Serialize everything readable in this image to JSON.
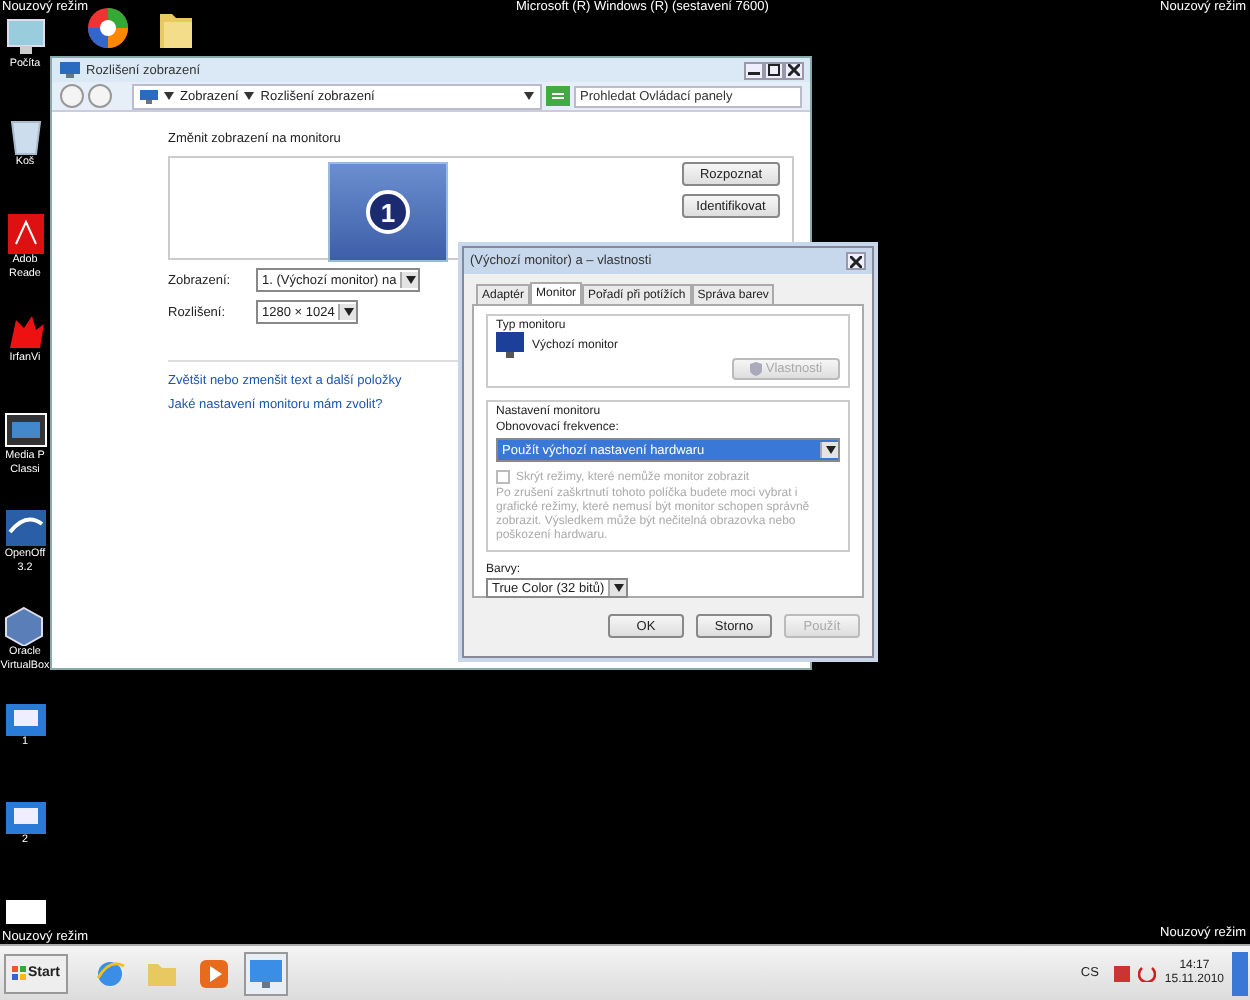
{
  "overlay_texts": {
    "top_left": "Nouzový režim",
    "top_center": "Microsoft (R) Windows (R) (sestavení 7600)",
    "top_right": "Nouzový režim",
    "bottom_left": "Nouzový režim",
    "bottom_right": "Nouzový režim"
  },
  "top_icons": [
    {
      "kind": "picasa"
    },
    {
      "kind": "folder"
    }
  ],
  "desktop_icons": [
    {
      "kind": "computer",
      "label": [
        "Počíta"
      ]
    },
    {
      "kind": "recycle",
      "label": [
        "Koš"
      ]
    },
    {
      "kind": "pdf",
      "label": [
        "Adob",
        "Reade"
      ]
    },
    {
      "kind": "irfan",
      "label": [
        "IrfanVi"
      ]
    },
    {
      "kind": "media",
      "label": [
        "Media P",
        "Classi"
      ]
    },
    {
      "kind": "office",
      "label": [
        "OpenOff",
        "3.2"
      ]
    },
    {
      "kind": "virtualbox",
      "label": [
        "Oracle",
        "VirtualBox"
      ]
    },
    {
      "kind": "screenshot",
      "label": [
        "1"
      ]
    },
    {
      "kind": "screenshot",
      "label": [
        "2"
      ]
    },
    {
      "kind": "blank"
    }
  ],
  "main_window": {
    "title": "Rozlišení zobrazení",
    "breadcrumb": [
      "Zobrazení",
      "Rozlišení zobrazení"
    ],
    "search": {
      "placeholder": "Prohledat Ovládací panely"
    },
    "heading": "Změnit zobrazení na monitoru",
    "monitor_number": "1",
    "buttons": [
      "Rozpoznat",
      "Identifikovat"
    ],
    "fields": [
      {
        "label": "Zobrazení:",
        "value": "1. (Výchozí monitor) na"
      },
      {
        "label": "Rozlišení:",
        "value": "1280 × 1024"
      }
    ],
    "links": [
      "Zvětšit nebo zmenšit text a další položky",
      "Jaké nastavení monitoru mám zvolit?"
    ]
  },
  "dialog": {
    "title": "(Výchozí monitor) a – vlastnosti",
    "tabs": [
      {
        "label": "Adaptér",
        "selected": false
      },
      {
        "label": "Monitor",
        "selected": true
      },
      {
        "label": "Pořadí při potížích",
        "selected": false
      },
      {
        "label": "Správa barev",
        "selected": false
      }
    ],
    "monitor_type": {
      "legend": "Typ monitoru",
      "name": "Výchozí monitor",
      "button": {
        "label": "Vlastnosti",
        "disabled": true
      }
    },
    "settings": {
      "legend": "Nastavení monitoru",
      "refresh_label": "Obnovovací frekvence:",
      "refresh_value": "Použít výchozí nastavení hardwaru",
      "checkbox": {
        "label": "Skrýt režimy, které nemůže monitor zobrazit",
        "checked": false,
        "disabled": true
      },
      "note": "Po zrušení zaškrtnutí tohoto políčka budete moci vybrat i grafické režimy, které nemusí být monitor schopen správně zobrazit. Výsledkem může být nečitelná obrazovka nebo poškození hardwaru."
    },
    "colors": {
      "label": "Barvy:",
      "value": "True Color (32 bitů)"
    },
    "buttons": [
      {
        "label": "OK",
        "disabled": false
      },
      {
        "label": "Storno",
        "disabled": false
      },
      {
        "label": "Použít",
        "disabled": true
      }
    ]
  },
  "taskbar": {
    "start": "Start",
    "apps": [
      {
        "kind": "ie",
        "selected": false
      },
      {
        "kind": "explorer",
        "selected": false
      },
      {
        "kind": "media",
        "selected": false
      },
      {
        "kind": "control_panel",
        "selected": true
      }
    ],
    "language": "CS",
    "time": "14:17",
    "date": "15.11.2010"
  }
}
